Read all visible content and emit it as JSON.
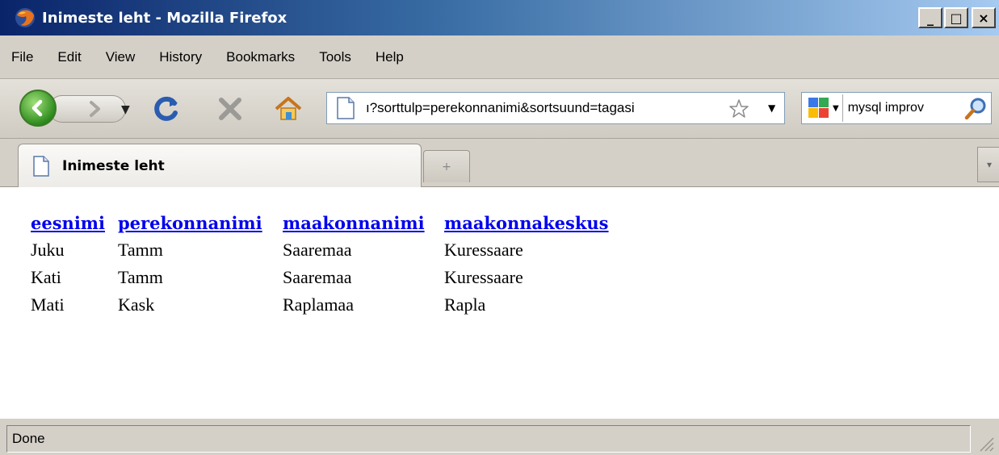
{
  "window": {
    "title": "Inimeste leht - Mozilla Firefox",
    "buttons": {
      "minimize": "_",
      "maximize": "□",
      "close": "×"
    }
  },
  "menu": {
    "items": [
      "File",
      "Edit",
      "View",
      "History",
      "Bookmarks",
      "Tools",
      "Help"
    ]
  },
  "nav": {
    "url": "ı?sorttulp=perekonnanimi&sortsuund=tagasi",
    "search_value": "mysql improv"
  },
  "tabs": {
    "active_label": "Inimeste leht",
    "new_tab_symbol": "+"
  },
  "table": {
    "headers": [
      "eesnimi",
      "perekonnanimi",
      "maakonnanimi",
      "maakonnakeskus"
    ],
    "rows": [
      [
        "Juku",
        "Tamm",
        "Saaremaa",
        "Kuressaare"
      ],
      [
        "Kati",
        "Tamm",
        "Saaremaa",
        "Kuressaare"
      ],
      [
        "Mati",
        "Kask",
        "Raplamaa",
        "Rapla"
      ]
    ]
  },
  "status": {
    "text": "Done"
  },
  "icons": {
    "app": "firefox-icon",
    "back": "back-arrow-icon",
    "forward": "forward-arrow-icon",
    "reload": "reload-icon",
    "stop": "stop-icon",
    "home": "home-icon",
    "bookmark": "star-icon",
    "search_engine": "google-icon",
    "search": "magnifier-icon"
  }
}
